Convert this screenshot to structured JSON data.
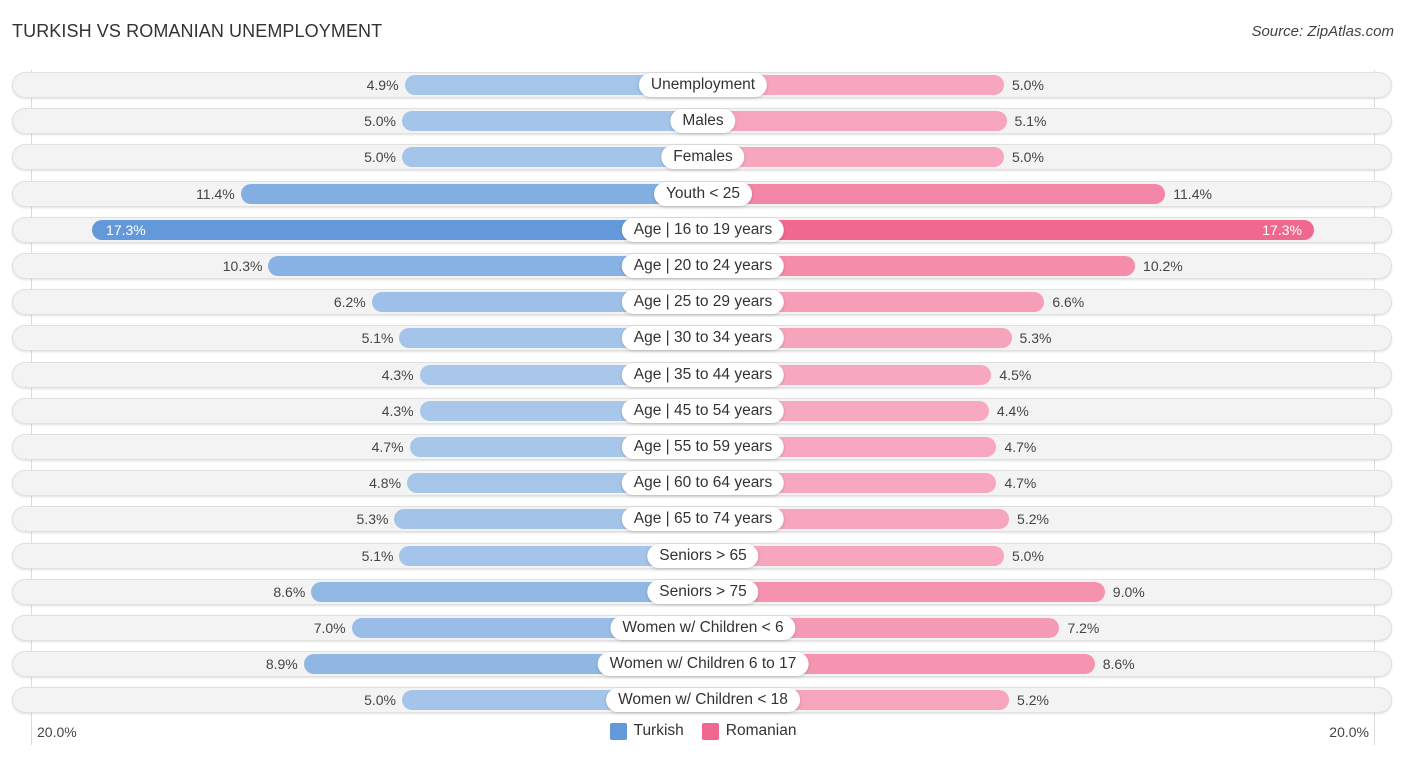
{
  "header": {
    "title": "TURKISH VS ROMANIAN UNEMPLOYMENT",
    "source": "Source: ZipAtlas.com"
  },
  "colors": {
    "turkish_dark": "#6399da",
    "turkish_light": "#a8c7ea",
    "romanian_dark": "#f06890",
    "romanian_light": "#f7a9c0",
    "row_background": "#f3f3f3"
  },
  "chart_data": {
    "type": "bar",
    "orientation": "horizontal-diverging",
    "title": "TURKISH VS ROMANIAN UNEMPLOYMENT",
    "xlabel": "",
    "ylabel": "",
    "unit": "%",
    "xlim": [
      -20.0,
      20.0
    ],
    "axis_labels": {
      "left": "20.0%",
      "right": "20.0%"
    },
    "legend": {
      "position": "bottom-center",
      "entries": [
        "Turkish",
        "Romanian"
      ]
    },
    "categories": [
      "Unemployment",
      "Males",
      "Females",
      "Youth < 25",
      "Age | 16 to 19 years",
      "Age | 20 to 24 years",
      "Age | 25 to 29 years",
      "Age | 30 to 34 years",
      "Age | 35 to 44 years",
      "Age | 45 to 54 years",
      "Age | 55 to 59 years",
      "Age | 60 to 64 years",
      "Age | 65 to 74 years",
      "Seniors > 65",
      "Seniors > 75",
      "Women w/ Children < 6",
      "Women w/ Children 6 to 17",
      "Women w/ Children < 18"
    ],
    "series": [
      {
        "name": "Turkish",
        "side": "left",
        "values": [
          4.9,
          5.0,
          5.0,
          11.4,
          17.3,
          10.3,
          6.2,
          5.1,
          4.3,
          4.3,
          4.7,
          4.8,
          5.3,
          5.1,
          8.6,
          7.0,
          8.9,
          5.0
        ],
        "labels": [
          "4.9%",
          "5.0%",
          "5.0%",
          "11.4%",
          "17.3%",
          "10.3%",
          "6.2%",
          "5.1%",
          "4.3%",
          "4.3%",
          "4.7%",
          "4.8%",
          "5.3%",
          "5.1%",
          "8.6%",
          "7.0%",
          "8.9%",
          "5.0%"
        ]
      },
      {
        "name": "Romanian",
        "side": "right",
        "values": [
          5.0,
          5.1,
          5.0,
          11.4,
          17.3,
          10.2,
          6.6,
          5.3,
          4.5,
          4.4,
          4.7,
          4.7,
          5.2,
          5.0,
          9.0,
          7.2,
          8.6,
          5.2
        ],
        "labels": [
          "5.0%",
          "5.1%",
          "5.0%",
          "11.4%",
          "17.3%",
          "10.2%",
          "6.6%",
          "5.3%",
          "4.5%",
          "4.4%",
          "4.7%",
          "4.7%",
          "5.2%",
          "5.0%",
          "9.0%",
          "7.2%",
          "8.6%",
          "5.2%"
        ]
      }
    ]
  }
}
